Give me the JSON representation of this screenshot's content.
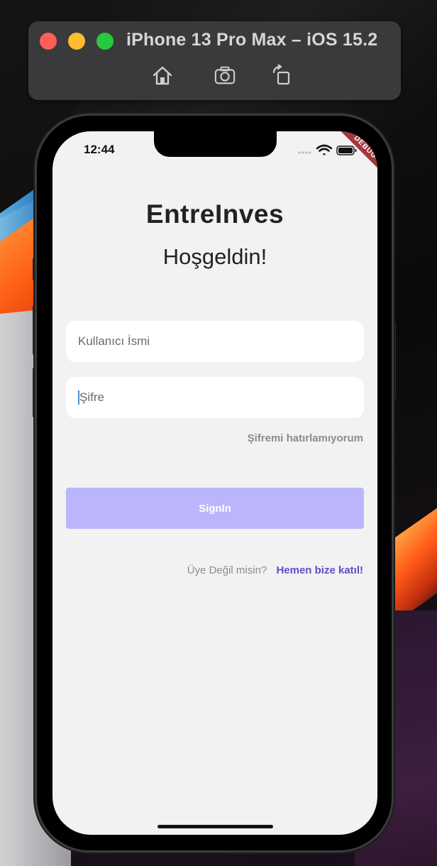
{
  "simulator": {
    "title": "iPhone 13 Pro Max – iOS 15.2",
    "buttons": [
      {
        "icon": "home-icon"
      },
      {
        "icon": "screenshot-icon"
      },
      {
        "icon": "rotate-icon"
      }
    ]
  },
  "status_bar": {
    "time": "12:44",
    "debug_label": "DEBUG"
  },
  "app": {
    "title": "EntreInves",
    "subtitle": "Hoşgeldin!",
    "username_placeholder": "Kullanıcı İsmi",
    "password_placeholder": "Şifre",
    "forgot_password": "Şifremi hatırlamıyorum",
    "signin_label": "SignIn",
    "signup_question": "Üye Değil misin?",
    "signup_link": "Hemen bize katıl!"
  },
  "colors": {
    "screen_bg": "#f3f2f3",
    "signin_button": "#bbb6fc",
    "link": "#5a50c8",
    "debug_banner": "#a4373d"
  }
}
